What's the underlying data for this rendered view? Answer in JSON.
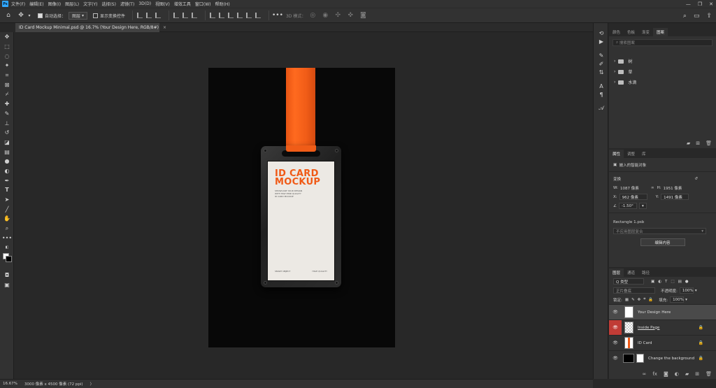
{
  "menubar": {
    "logo": "Ps",
    "items": [
      "文件(F)",
      "编辑(E)",
      "图像(I)",
      "图层(L)",
      "文字(Y)",
      "选择(S)",
      "滤镜(T)",
      "3D(D)",
      "视图(V)",
      "增效工具",
      "窗口(W)",
      "帮助(H)"
    ],
    "minimize": "—",
    "maximize": "❐",
    "close": "✕"
  },
  "options": {
    "auto_select_label": "自动选择：",
    "auto_select_value": "图层",
    "show_transform_label": "显示变换控件",
    "mode_3d_label": "3D 模式："
  },
  "tab": {
    "title": "ID Card Mockup Minimal.psd @ 16.7% (Your Design Here, RGB/8#)",
    "close": "×"
  },
  "card": {
    "title_line1": "ID CARD",
    "title_line2": "MOCKUP",
    "desc_lines": [
      "SHOWCASE YOUR DESIGN",
      "WITH HIGH END QUALITY",
      "ID CARD MOCKUP"
    ],
    "footer_left": "SMART OBJECT",
    "footer_right": "HIGH QUALITY"
  },
  "layers_top_panel": {
    "tabs": [
      "颜色",
      "色板",
      "渐变",
      "图案"
    ],
    "active_tab": 3,
    "search_placeholder": "搜索图案",
    "groups": [
      "树",
      "草",
      "水滴"
    ]
  },
  "properties": {
    "tabs": [
      "属性",
      "调整",
      "库"
    ],
    "active_tab": 0,
    "object_type": "嵌入的智能对象",
    "transform_label": "变换",
    "w_label": "W:",
    "w_value": "1087 像素",
    "h_label": "H:",
    "h_value": "1951 像素",
    "x_label": "X:",
    "x_value": "962 像素",
    "y_label": "Y:",
    "y_value": "1491 像素",
    "angle_value": "-1.50°",
    "file_name": "Rectangle 1.psb",
    "comp_placeholder": "不应用图层复合",
    "edit_button": "编辑内容"
  },
  "layers": {
    "tabs": [
      "图层",
      "通道",
      "路径"
    ],
    "active_tab": 0,
    "filter_label": "Q 类型",
    "blend_mode": "正片叠底",
    "opacity_label": "不透明度:",
    "opacity_value": "100%",
    "lock_label": "锁定:",
    "fill_label": "填充:",
    "fill_value": "100%",
    "items": [
      {
        "name": "Your Design Here",
        "selected": true,
        "locked": false
      },
      {
        "name": "Inside Page",
        "selected": false,
        "locked": true
      },
      {
        "name": "ID Card",
        "selected": false,
        "locked": true
      },
      {
        "name": "Change the background",
        "selected": false,
        "locked": true
      }
    ]
  },
  "status": {
    "zoom": "16.67%",
    "doc_size": "3000 像素 x 4500 像素 (72 ppi)",
    "arrow": "〉"
  },
  "colors": {
    "accent_orange": "#f05a16",
    "ps_blue": "#31a8ff",
    "red_eye": "#c03c36"
  }
}
